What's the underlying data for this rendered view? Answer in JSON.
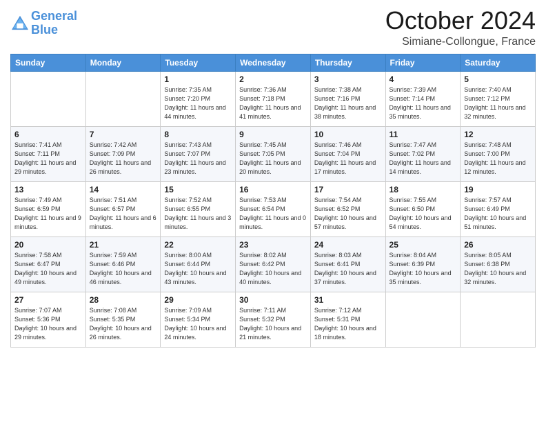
{
  "logo": {
    "line1": "General",
    "line2": "Blue"
  },
  "title": "October 2024",
  "subtitle": "Simiane-Collongue, France",
  "headers": [
    "Sunday",
    "Monday",
    "Tuesday",
    "Wednesday",
    "Thursday",
    "Friday",
    "Saturday"
  ],
  "weeks": [
    [
      {
        "day": "",
        "sunrise": "",
        "sunset": "",
        "daylight": ""
      },
      {
        "day": "",
        "sunrise": "",
        "sunset": "",
        "daylight": ""
      },
      {
        "day": "1",
        "sunrise": "Sunrise: 7:35 AM",
        "sunset": "Sunset: 7:20 PM",
        "daylight": "Daylight: 11 hours and 44 minutes."
      },
      {
        "day": "2",
        "sunrise": "Sunrise: 7:36 AM",
        "sunset": "Sunset: 7:18 PM",
        "daylight": "Daylight: 11 hours and 41 minutes."
      },
      {
        "day": "3",
        "sunrise": "Sunrise: 7:38 AM",
        "sunset": "Sunset: 7:16 PM",
        "daylight": "Daylight: 11 hours and 38 minutes."
      },
      {
        "day": "4",
        "sunrise": "Sunrise: 7:39 AM",
        "sunset": "Sunset: 7:14 PM",
        "daylight": "Daylight: 11 hours and 35 minutes."
      },
      {
        "day": "5",
        "sunrise": "Sunrise: 7:40 AM",
        "sunset": "Sunset: 7:12 PM",
        "daylight": "Daylight: 11 hours and 32 minutes."
      }
    ],
    [
      {
        "day": "6",
        "sunrise": "Sunrise: 7:41 AM",
        "sunset": "Sunset: 7:11 PM",
        "daylight": "Daylight: 11 hours and 29 minutes."
      },
      {
        "day": "7",
        "sunrise": "Sunrise: 7:42 AM",
        "sunset": "Sunset: 7:09 PM",
        "daylight": "Daylight: 11 hours and 26 minutes."
      },
      {
        "day": "8",
        "sunrise": "Sunrise: 7:43 AM",
        "sunset": "Sunset: 7:07 PM",
        "daylight": "Daylight: 11 hours and 23 minutes."
      },
      {
        "day": "9",
        "sunrise": "Sunrise: 7:45 AM",
        "sunset": "Sunset: 7:05 PM",
        "daylight": "Daylight: 11 hours and 20 minutes."
      },
      {
        "day": "10",
        "sunrise": "Sunrise: 7:46 AM",
        "sunset": "Sunset: 7:04 PM",
        "daylight": "Daylight: 11 hours and 17 minutes."
      },
      {
        "day": "11",
        "sunrise": "Sunrise: 7:47 AM",
        "sunset": "Sunset: 7:02 PM",
        "daylight": "Daylight: 11 hours and 14 minutes."
      },
      {
        "day": "12",
        "sunrise": "Sunrise: 7:48 AM",
        "sunset": "Sunset: 7:00 PM",
        "daylight": "Daylight: 11 hours and 12 minutes."
      }
    ],
    [
      {
        "day": "13",
        "sunrise": "Sunrise: 7:49 AM",
        "sunset": "Sunset: 6:59 PM",
        "daylight": "Daylight: 11 hours and 9 minutes."
      },
      {
        "day": "14",
        "sunrise": "Sunrise: 7:51 AM",
        "sunset": "Sunset: 6:57 PM",
        "daylight": "Daylight: 11 hours and 6 minutes."
      },
      {
        "day": "15",
        "sunrise": "Sunrise: 7:52 AM",
        "sunset": "Sunset: 6:55 PM",
        "daylight": "Daylight: 11 hours and 3 minutes."
      },
      {
        "day": "16",
        "sunrise": "Sunrise: 7:53 AM",
        "sunset": "Sunset: 6:54 PM",
        "daylight": "Daylight: 11 hours and 0 minutes."
      },
      {
        "day": "17",
        "sunrise": "Sunrise: 7:54 AM",
        "sunset": "Sunset: 6:52 PM",
        "daylight": "Daylight: 10 hours and 57 minutes."
      },
      {
        "day": "18",
        "sunrise": "Sunrise: 7:55 AM",
        "sunset": "Sunset: 6:50 PM",
        "daylight": "Daylight: 10 hours and 54 minutes."
      },
      {
        "day": "19",
        "sunrise": "Sunrise: 7:57 AM",
        "sunset": "Sunset: 6:49 PM",
        "daylight": "Daylight: 10 hours and 51 minutes."
      }
    ],
    [
      {
        "day": "20",
        "sunrise": "Sunrise: 7:58 AM",
        "sunset": "Sunset: 6:47 PM",
        "daylight": "Daylight: 10 hours and 49 minutes."
      },
      {
        "day": "21",
        "sunrise": "Sunrise: 7:59 AM",
        "sunset": "Sunset: 6:46 PM",
        "daylight": "Daylight: 10 hours and 46 minutes."
      },
      {
        "day": "22",
        "sunrise": "Sunrise: 8:00 AM",
        "sunset": "Sunset: 6:44 PM",
        "daylight": "Daylight: 10 hours and 43 minutes."
      },
      {
        "day": "23",
        "sunrise": "Sunrise: 8:02 AM",
        "sunset": "Sunset: 6:42 PM",
        "daylight": "Daylight: 10 hours and 40 minutes."
      },
      {
        "day": "24",
        "sunrise": "Sunrise: 8:03 AM",
        "sunset": "Sunset: 6:41 PM",
        "daylight": "Daylight: 10 hours and 37 minutes."
      },
      {
        "day": "25",
        "sunrise": "Sunrise: 8:04 AM",
        "sunset": "Sunset: 6:39 PM",
        "daylight": "Daylight: 10 hours and 35 minutes."
      },
      {
        "day": "26",
        "sunrise": "Sunrise: 8:05 AM",
        "sunset": "Sunset: 6:38 PM",
        "daylight": "Daylight: 10 hours and 32 minutes."
      }
    ],
    [
      {
        "day": "27",
        "sunrise": "Sunrise: 7:07 AM",
        "sunset": "Sunset: 5:36 PM",
        "daylight": "Daylight: 10 hours and 29 minutes."
      },
      {
        "day": "28",
        "sunrise": "Sunrise: 7:08 AM",
        "sunset": "Sunset: 5:35 PM",
        "daylight": "Daylight: 10 hours and 26 minutes."
      },
      {
        "day": "29",
        "sunrise": "Sunrise: 7:09 AM",
        "sunset": "Sunset: 5:34 PM",
        "daylight": "Daylight: 10 hours and 24 minutes."
      },
      {
        "day": "30",
        "sunrise": "Sunrise: 7:11 AM",
        "sunset": "Sunset: 5:32 PM",
        "daylight": "Daylight: 10 hours and 21 minutes."
      },
      {
        "day": "31",
        "sunrise": "Sunrise: 7:12 AM",
        "sunset": "Sunset: 5:31 PM",
        "daylight": "Daylight: 10 hours and 18 minutes."
      },
      {
        "day": "",
        "sunrise": "",
        "sunset": "",
        "daylight": ""
      },
      {
        "day": "",
        "sunrise": "",
        "sunset": "",
        "daylight": ""
      }
    ]
  ]
}
